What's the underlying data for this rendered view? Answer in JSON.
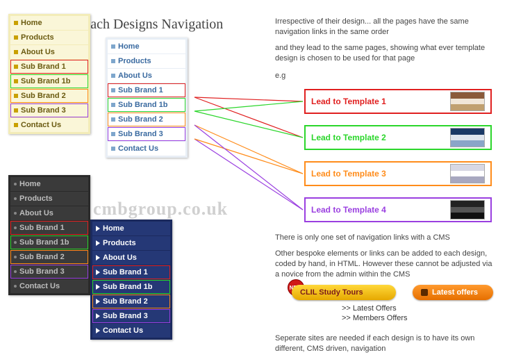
{
  "title": "Each Designs Navigation",
  "watermark": "cmbgroup.co.uk",
  "nav_items": [
    {
      "label": "Home"
    },
    {
      "label": "Products"
    },
    {
      "label": "About Us"
    },
    {
      "label": "Sub Brand 1",
      "outline": "red"
    },
    {
      "label": "Sub Brand 1b",
      "outline": "green"
    },
    {
      "label": "Sub Brand 2",
      "outline": "orange"
    },
    {
      "label": "Sub Brand 3",
      "outline": "purple"
    },
    {
      "label": "Contact Us"
    }
  ],
  "paras": {
    "p1": "Irrespective of their design... all the pages have the same navigation links in the same order",
    "p2": "and they lead to the same pages, showing what ever template design is chosen to be used for that page",
    "p3": "e.g",
    "p4": "There is only one set of navigation links with a CMS",
    "p5": "Other bespoke elements or links can be added to each design, coded by hand, in HTML. However these cannot be adjusted via a novice from the admin within the CMS",
    "p6": "Seperate sites are needed if each design is to have its own different, CMS driven, navigation"
  },
  "leads": [
    {
      "label": "Lead to Template 1"
    },
    {
      "label": "Lead to Template 2"
    },
    {
      "label": "Lead to Template 3"
    },
    {
      "label": "Lead to Template 4"
    }
  ],
  "buttons": {
    "new_badge": "NEW",
    "yellow": "CLIL Study Tours",
    "orange": "Latest offers"
  },
  "link_list": [
    ">> Latest Offers",
    ">> Members Offers"
  ]
}
